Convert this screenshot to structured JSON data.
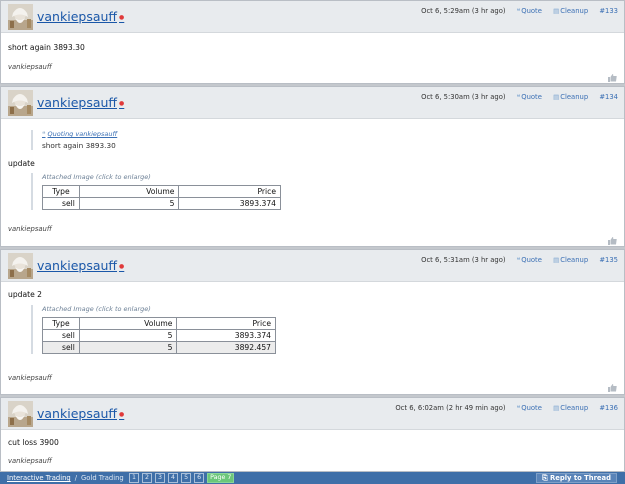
{
  "posts": [
    {
      "username": "vankiepsauff",
      "time": "Oct 6, 5:29am (3 hr ago)",
      "quote_label": "Quote",
      "cleanup_label": "Cleanup",
      "number": "#133",
      "text": "short again 3893.30",
      "signature": "vankiepsauff"
    },
    {
      "username": "vankiepsauff",
      "time": "Oct 6, 5:30am (3 hr ago)",
      "quote_label": "Quote",
      "cleanup_label": "Cleanup",
      "number": "#134",
      "quoting": "Quoting vankiepsauff",
      "quoted_text": "short again 3893.30",
      "text": "update",
      "attach_caption": "Attached Image (click to enlarge)",
      "table": {
        "headers": [
          "Type",
          "Volume",
          "Price"
        ],
        "rows": [
          [
            "sell",
            "5",
            "3893.374"
          ]
        ]
      },
      "signature": "vankiepsauff"
    },
    {
      "username": "vankiepsauff",
      "time": "Oct 6, 5:31am (3 hr ago)",
      "quote_label": "Quote",
      "cleanup_label": "Cleanup",
      "number": "#135",
      "text": "update 2",
      "attach_caption": "Attached Image (click to enlarge)",
      "table": {
        "headers": [
          "Type",
          "Volume",
          "Price"
        ],
        "rows": [
          [
            "sell",
            "5",
            "3893.374"
          ],
          [
            "sell",
            "5",
            "3892.457"
          ]
        ]
      },
      "signature": "vankiepsauff"
    },
    {
      "username": "vankiepsauff",
      "time": "Oct 6, 6:02am (2 hr 49 min ago)",
      "quote_label": "Quote",
      "cleanup_label": "Cleanup",
      "number": "#136",
      "text": "cut loss 3900",
      "signature": "vankiepsauff"
    }
  ],
  "footer": {
    "crumb_1": "Interactive Trading",
    "separator": "/",
    "crumb_2": "Gold Trading",
    "pages": [
      "1",
      "2",
      "3",
      "4",
      "5",
      "6"
    ],
    "current_page": "Page 7",
    "reply_label": "Reply to Thread"
  },
  "colors": {
    "link": "#1a57a8",
    "header_bg": "#e8ebee",
    "footer_bg": "#3f6fa8",
    "current_page": "#6cc77a"
  },
  "icons": [
    "avatar-image",
    "online-dot-icon",
    "quote-icon",
    "cleanup-icon",
    "thumbs-up-icon",
    "reply-icon"
  ]
}
